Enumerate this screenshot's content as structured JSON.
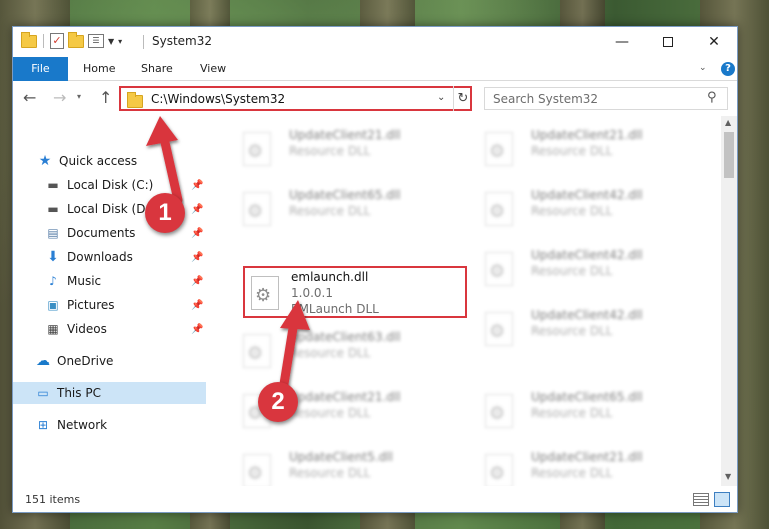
{
  "window": {
    "title": "System32"
  },
  "ribbon": {
    "tabs": [
      "File",
      "Home",
      "Share",
      "View"
    ]
  },
  "address": {
    "path": "C:\\Windows\\System32",
    "search_placeholder": "Search System32"
  },
  "sidebar": {
    "items": [
      {
        "label": "Quick access",
        "icon": "star-icon"
      },
      {
        "label": "Local Disk (C:)",
        "icon": "drive-icon",
        "pinned": true
      },
      {
        "label": "Local Disk (D:)",
        "icon": "drive-icon",
        "pinned": true
      },
      {
        "label": "Documents",
        "icon": "documents-icon",
        "pinned": true
      },
      {
        "label": "Downloads",
        "icon": "download-icon",
        "pinned": true
      },
      {
        "label": "Music",
        "icon": "music-icon",
        "pinned": true
      },
      {
        "label": "Pictures",
        "icon": "pictures-icon",
        "pinned": true
      },
      {
        "label": "Videos",
        "icon": "videos-icon",
        "pinned": true
      },
      {
        "label": "OneDrive",
        "icon": "cloud-icon"
      },
      {
        "label": "This PC",
        "icon": "computer-icon",
        "selected": true
      },
      {
        "label": "Network",
        "icon": "network-icon"
      }
    ]
  },
  "files": [
    {
      "name": "UpdateClient21.dll",
      "line2": "Resource DLL",
      "line3": "",
      "blurred": true
    },
    {
      "name": "UpdateClient21.dll",
      "line2": "Resource DLL",
      "line3": "",
      "blurred": true
    },
    {
      "name": "UpdateClient65.dll",
      "line2": "Resource DLL",
      "line3": "",
      "blurred": true
    },
    {
      "name": "UpdateClient42.dll",
      "line2": "Resource DLL",
      "line3": "",
      "blurred": true
    },
    {
      "name": "emlaunch.dll",
      "line2": "1.0.0.1",
      "line3": "EMLaunch DLL",
      "blurred": false,
      "highlighted": true
    },
    {
      "name": "UpdateClient42.dll",
      "line2": "Resource DLL",
      "line3": "",
      "blurred": true
    },
    {
      "name": "UpdateClient63.dll",
      "line2": "Resource DLL",
      "line3": "",
      "blurred": true
    },
    {
      "name": "UpdateClient42.dll",
      "line2": "Resource DLL",
      "line3": "",
      "blurred": true
    },
    {
      "name": "UpdateClient21.dll",
      "line2": "Resource DLL",
      "line3": "",
      "blurred": true
    },
    {
      "name": "UpdateClient65.dll",
      "line2": "Resource DLL",
      "line3": "",
      "blurred": true
    },
    {
      "name": "UpdateClient5.dll",
      "line2": "Resource DLL",
      "line3": "",
      "blurred": true
    },
    {
      "name": "UpdateClient21.dll",
      "line2": "Resource DLL",
      "line3": "",
      "blurred": true
    }
  ],
  "status": {
    "item_count": "151 items"
  },
  "annotations": {
    "step1": "1",
    "step2": "2",
    "color": "#d9363e"
  }
}
